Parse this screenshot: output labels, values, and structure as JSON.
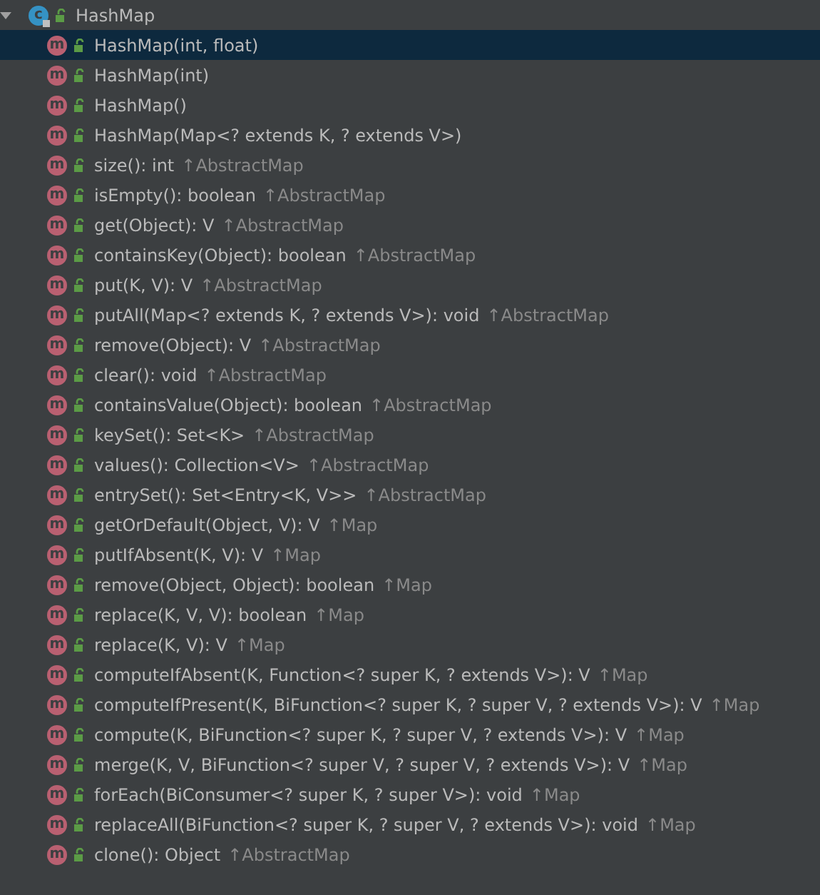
{
  "tree": {
    "label": "HashMap",
    "badge": "c",
    "expanded": true,
    "selected": false,
    "children": [
      {
        "label": "HashMap(int, float)",
        "badge": "m",
        "selected": true
      },
      {
        "label": "HashMap(int)",
        "badge": "m",
        "selected": false
      },
      {
        "label": "HashMap()",
        "badge": "m",
        "selected": false
      },
      {
        "label": "HashMap(Map<? extends K, ? extends V>)",
        "badge": "m",
        "selected": false
      },
      {
        "label": "size(): int",
        "badge": "m",
        "inherited": "↑AbstractMap",
        "selected": false
      },
      {
        "label": "isEmpty(): boolean",
        "badge": "m",
        "inherited": "↑AbstractMap",
        "selected": false
      },
      {
        "label": "get(Object): V",
        "badge": "m",
        "inherited": "↑AbstractMap",
        "selected": false
      },
      {
        "label": "containsKey(Object): boolean",
        "badge": "m",
        "inherited": "↑AbstractMap",
        "selected": false
      },
      {
        "label": "put(K, V): V",
        "badge": "m",
        "inherited": "↑AbstractMap",
        "selected": false
      },
      {
        "label": "putAll(Map<? extends K, ? extends V>): void",
        "badge": "m",
        "inherited": "↑AbstractMap",
        "selected": false
      },
      {
        "label": "remove(Object): V",
        "badge": "m",
        "inherited": "↑AbstractMap",
        "selected": false
      },
      {
        "label": "clear(): void",
        "badge": "m",
        "inherited": "↑AbstractMap",
        "selected": false
      },
      {
        "label": "containsValue(Object): boolean",
        "badge": "m",
        "inherited": "↑AbstractMap",
        "selected": false
      },
      {
        "label": "keySet(): Set<K>",
        "badge": "m",
        "inherited": "↑AbstractMap",
        "selected": false
      },
      {
        "label": "values(): Collection<V>",
        "badge": "m",
        "inherited": "↑AbstractMap",
        "selected": false
      },
      {
        "label": "entrySet(): Set<Entry<K, V>>",
        "badge": "m",
        "inherited": "↑AbstractMap",
        "selected": false
      },
      {
        "label": "getOrDefault(Object, V): V",
        "badge": "m",
        "inherited": "↑Map",
        "selected": false
      },
      {
        "label": "putIfAbsent(K, V): V",
        "badge": "m",
        "inherited": "↑Map",
        "selected": false
      },
      {
        "label": "remove(Object, Object): boolean",
        "badge": "m",
        "inherited": "↑Map",
        "selected": false
      },
      {
        "label": "replace(K, V, V): boolean",
        "badge": "m",
        "inherited": "↑Map",
        "selected": false
      },
      {
        "label": "replace(K, V): V",
        "badge": "m",
        "inherited": "↑Map",
        "selected": false
      },
      {
        "label": "computeIfAbsent(K, Function<? super K, ? extends V>): V",
        "badge": "m",
        "inherited": "↑Map",
        "selected": false
      },
      {
        "label": "computeIfPresent(K, BiFunction<? super K, ? super V, ? extends V>): V",
        "badge": "m",
        "inherited": "↑Map",
        "selected": false
      },
      {
        "label": "compute(K, BiFunction<? super K, ? super V, ? extends V>): V",
        "badge": "m",
        "inherited": "↑Map",
        "selected": false
      },
      {
        "label": "merge(K, V, BiFunction<? super V, ? super V, ? extends V>): V",
        "badge": "m",
        "inherited": "↑Map",
        "selected": false
      },
      {
        "label": "forEach(BiConsumer<? super K, ? super V>): void",
        "badge": "m",
        "inherited": "↑Map",
        "selected": false
      },
      {
        "label": "replaceAll(BiFunction<? super K, ? super V, ? extends V>): void",
        "badge": "m",
        "inherited": "↑Map",
        "selected": false
      },
      {
        "label": "clone(): Object",
        "badge": "m",
        "inherited": "↑AbstractMap",
        "selected": false
      }
    ]
  }
}
